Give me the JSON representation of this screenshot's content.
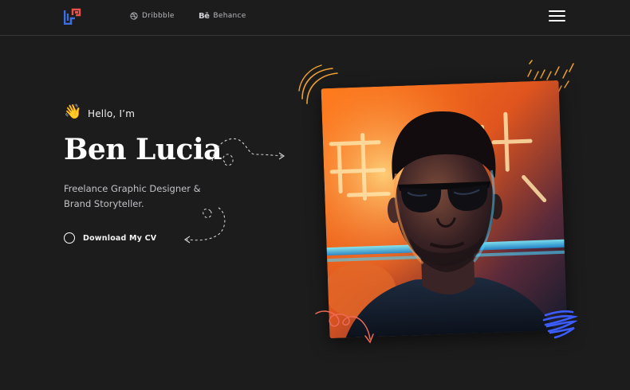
{
  "header": {
    "logo_name": "brand-logo",
    "nav": [
      {
        "label": "Dribbble",
        "icon": "dribbble-icon"
      },
      {
        "label": "Behance",
        "icon": "behance-icon",
        "icon_text": "Bē"
      }
    ],
    "menu_icon": "hamburger-menu-icon"
  },
  "hero": {
    "greeting_emoji": "👋",
    "greeting": "Hello, I’m",
    "name": "Ben Lucia",
    "subtitle": "Freelance Graphic Designer & Brand Storyteller.",
    "cta_label": "Download My CV"
  },
  "colors": {
    "background": "#1c1c1d",
    "logo_blue": "#3d6fe0",
    "logo_red": "#e8524a",
    "accent_orange": "#f0a332",
    "accent_blue": "#3b5cff",
    "accent_coral": "#ef6a55"
  }
}
